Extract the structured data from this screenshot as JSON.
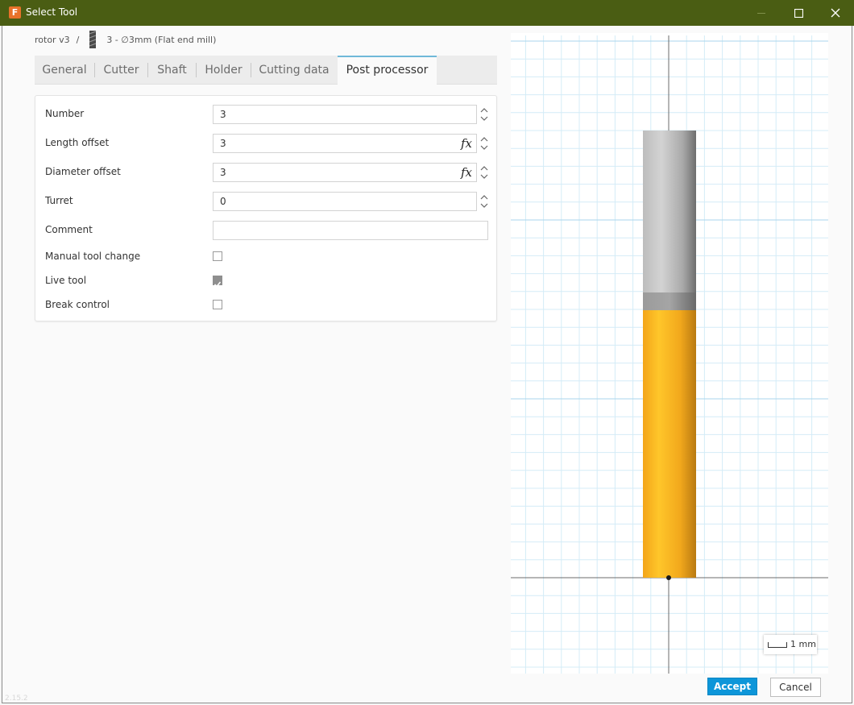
{
  "window": {
    "title": "Select Tool",
    "app_icon_letter": "F"
  },
  "breadcrumb": {
    "project": "rotor v3",
    "separator": "/",
    "tool": "3 - ∅3mm (Flat end mill)"
  },
  "tabs": [
    {
      "label": "General",
      "active": false
    },
    {
      "label": "Cutter",
      "active": false
    },
    {
      "label": "Shaft",
      "active": false
    },
    {
      "label": "Holder",
      "active": false
    },
    {
      "label": "Cutting data",
      "active": false
    },
    {
      "label": "Post processor",
      "active": true
    }
  ],
  "form": {
    "number": {
      "label": "Number",
      "value": "3"
    },
    "length_offset": {
      "label": "Length offset",
      "value": "3",
      "fx": "fx"
    },
    "diameter_offset": {
      "label": "Diameter offset",
      "value": "3",
      "fx": "fx"
    },
    "turret": {
      "label": "Turret",
      "value": "0"
    },
    "comment": {
      "label": "Comment",
      "value": ""
    },
    "manual_tool_change": {
      "label": "Manual tool change",
      "checked": false
    },
    "live_tool": {
      "label": "Live tool",
      "checked": true
    },
    "break_control": {
      "label": "Break control",
      "checked": false
    }
  },
  "preview": {
    "scale_label": "1 mm",
    "colors": {
      "cutter": "#f5ad1e",
      "shaft": "#a8a8a8",
      "neck": "#8f8f8f",
      "grid_minor": "#d4ecf7",
      "grid_major": "#a9d6ec",
      "axis": "#6b6b6b"
    }
  },
  "buttons": {
    "accept": "Accept",
    "cancel": "Cancel"
  },
  "footer": {
    "version": "2.15.2"
  },
  "colors": {
    "titlebar": "#4a5d13",
    "accent": "#0d96d9",
    "tab_active_border": "#6fb8d8"
  }
}
